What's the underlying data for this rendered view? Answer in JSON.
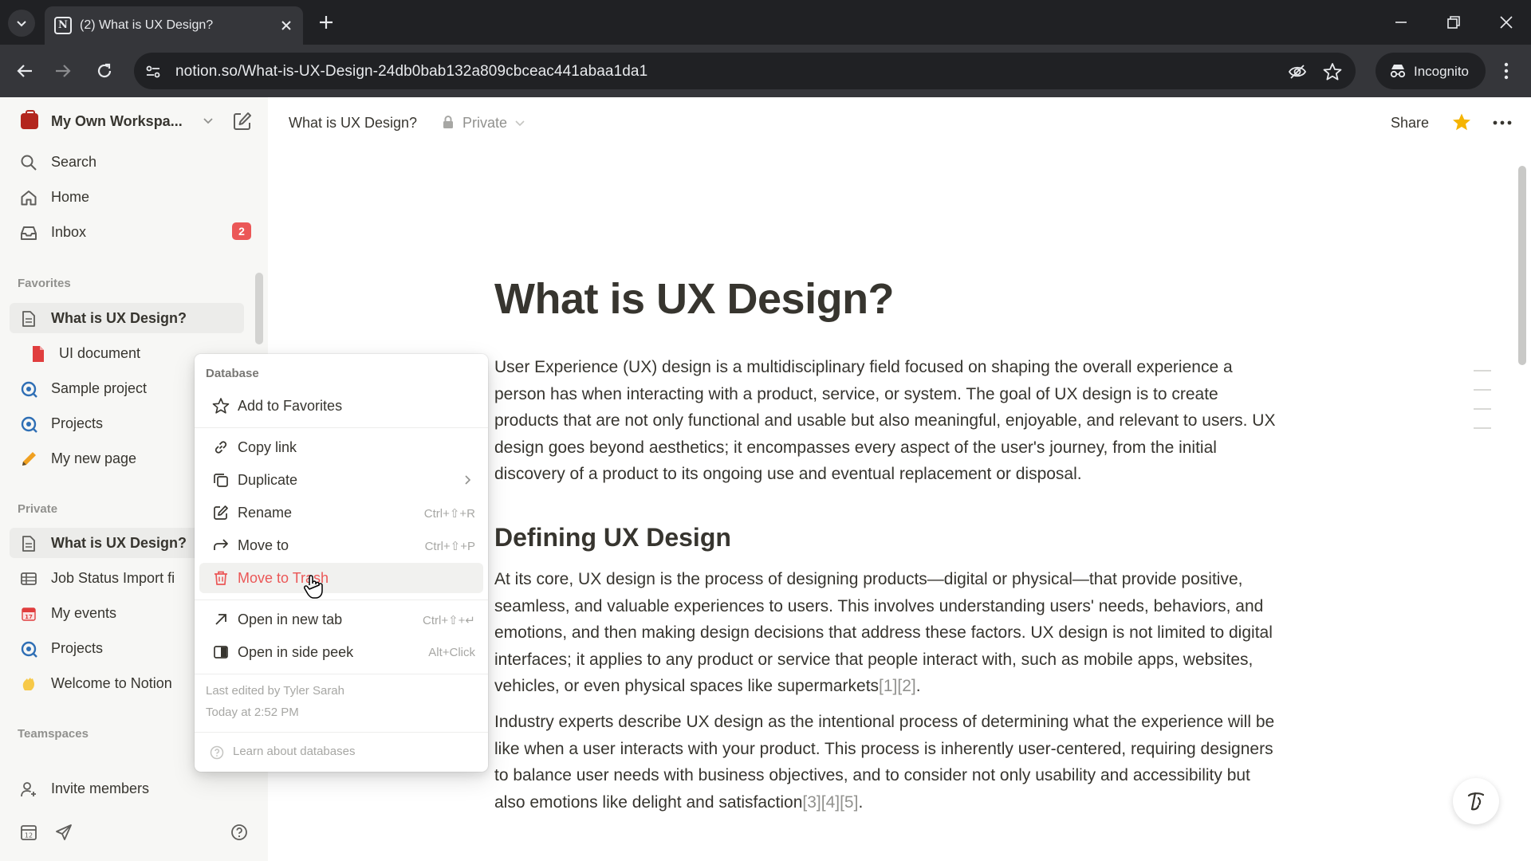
{
  "browser": {
    "tab_title": "(2) What is UX Design?",
    "url": "notion.so/What-is-UX-Design-24db0bab132a809cbceac441abaa1da1",
    "incognito_label": "Incognito"
  },
  "sidebar": {
    "workspace_name": "My Own Workspa...",
    "top_items": [
      {
        "label": "Search",
        "icon": "search-icon"
      },
      {
        "label": "Home",
        "icon": "home-icon"
      },
      {
        "label": "Inbox",
        "icon": "inbox-icon",
        "badge": "2"
      }
    ],
    "favorites_heading": "Favorites",
    "favorites": [
      {
        "label": "What is UX Design?",
        "icon": "page-icon"
      },
      {
        "label": "UI document",
        "icon": "document-icon"
      },
      {
        "label": "Sample project",
        "icon": "project-icon"
      },
      {
        "label": "Projects",
        "icon": "project-icon"
      },
      {
        "label": "My new page",
        "icon": "pencil-icon"
      }
    ],
    "private_heading": "Private",
    "private": [
      {
        "label": "What is UX Design?",
        "icon": "page-icon"
      },
      {
        "label": "Job Status Import fi",
        "icon": "table-icon"
      },
      {
        "label": "My events",
        "icon": "calendar-icon"
      },
      {
        "label": "Projects",
        "icon": "project-icon"
      },
      {
        "label": "Welcome to Notion",
        "icon": "wave-icon"
      }
    ],
    "teamspaces_heading": "Teamspaces",
    "invite_label": "Invite members"
  },
  "header": {
    "breadcrumb": "What is UX Design?",
    "privacy": "Private",
    "share_label": "Share",
    "star_color": "#f5b400"
  },
  "doc": {
    "title": "What is UX Design?",
    "p1": "User Experience (UX) design is a multidisciplinary field focused on shaping the overall experience a person has when interacting with a product, service, or system. The goal of UX design is to create products that are not only functional and usable but also meaningful, enjoyable, and relevant to users. UX design goes beyond aesthetics; it encompasses every aspect of the user's journey, from the initial discovery of a product to its ongoing use and eventual replacement or disposal.",
    "h2": "Defining UX Design",
    "p2_text": "At its core, UX design is the process of designing products—digital or physical—that provide positive, seamless, and valuable experiences to users. This involves understanding users' needs, behaviors, and emotions, and then making design decisions that address these factors. UX design is not limited to digital interfaces; it applies to any product or service that people interact with, such as mobile apps, websites, vehicles, or even physical spaces like supermarkets",
    "p2_cite": "[1][2]",
    "p2_end": ".",
    "p3_text": "Industry experts describe UX design as the intentional process of determining what the experience will be like when a user interacts with your product. This process is inherently user-centered, requiring designers to balance user needs with business objectives, and to consider not only usability and accessibility but also emotions like delight and satisfaction",
    "p3_cite": "[3][4][5]",
    "p3_end": "."
  },
  "menu": {
    "heading": "Database",
    "items": [
      {
        "label": "Add to Favorites",
        "icon": "star-outline-icon",
        "shortcut": ""
      },
      {
        "label": "Copy link",
        "icon": "link-icon",
        "shortcut": ""
      },
      {
        "label": "Duplicate",
        "icon": "duplicate-icon",
        "shortcut": ""
      },
      {
        "label": "Rename",
        "icon": "rename-icon",
        "shortcut": "Ctrl+⇧+R"
      },
      {
        "label": "Move to",
        "icon": "move-arrow-icon",
        "shortcut": "Ctrl+⇧+P"
      },
      {
        "label": "Move to Trash",
        "icon": "trash-icon",
        "shortcut": ""
      },
      {
        "label": "Open in new tab",
        "icon": "open-new-tab-icon",
        "shortcut": "Ctrl+⇧+↵"
      },
      {
        "label": "Open in side peek",
        "icon": "side-peek-icon",
        "shortcut": "Alt+Click"
      }
    ],
    "last_edited": "Last edited by Tyler Sarah",
    "last_edited_time": "Today at 2:52 PM",
    "learn": "Learn about databases",
    "danger_color": "#eb5757"
  }
}
